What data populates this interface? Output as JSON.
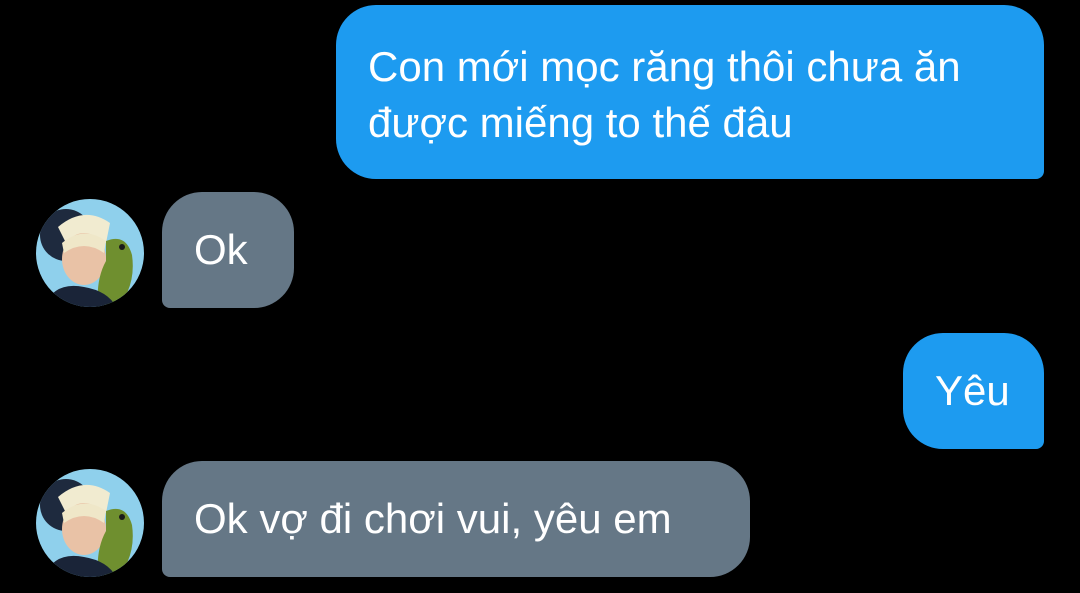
{
  "conversation": {
    "messages": [
      {
        "side": "sent",
        "text": "Con mới mọc răng thôi chưa ăn được miếng to thế đâu"
      },
      {
        "side": "received",
        "text": "Ok"
      },
      {
        "side": "sent",
        "text": "Yêu"
      },
      {
        "side": "received",
        "text": "Ok vợ đi chơi vui, yêu em"
      }
    ]
  },
  "colors": {
    "background": "#000000",
    "sent_bubble": "#1d9bf0",
    "received_bubble": "#657786",
    "text": "#ffffff"
  },
  "icons": {
    "avatar": "contact-avatar-photo"
  }
}
